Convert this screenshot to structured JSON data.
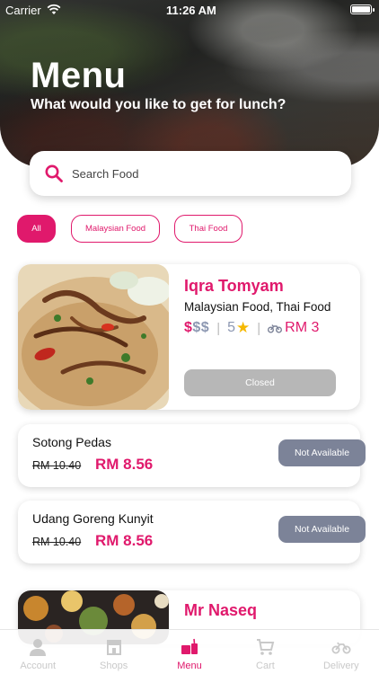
{
  "status_bar": {
    "carrier": "Carrier",
    "time": "11:26 AM"
  },
  "header": {
    "title": "Menu",
    "subtitle": "What would you like to get for lunch?"
  },
  "search": {
    "placeholder": "Search Food",
    "value": ""
  },
  "filters": [
    {
      "label": "All",
      "active": true
    },
    {
      "label": "Malaysian Food",
      "active": false
    },
    {
      "label": "Thai Food",
      "active": false
    }
  ],
  "restaurants": [
    {
      "name": "Iqra Tomyam",
      "cuisine": "Malaysian Food, Thai Food",
      "price_level_active": "$",
      "price_level_inactive": "$$",
      "rating": "5",
      "delivery_fee": "RM 3",
      "status_button": "Closed"
    },
    {
      "name": "Mr Naseq"
    }
  ],
  "menu_items": [
    {
      "name": "Sotong Pedas",
      "old_price": "RM 10.40",
      "new_price": "RM 8.56",
      "status": "Not Available"
    },
    {
      "name": "Udang Goreng Kunyit",
      "old_price": "RM 10.40",
      "new_price": "RM 8.56",
      "status": "Not Available"
    }
  ],
  "tab_bar": {
    "active": "Menu",
    "tabs": [
      {
        "label": "Account",
        "icon": "account-icon"
      },
      {
        "label": "Shops",
        "icon": "shop-icon"
      },
      {
        "label": "Menu",
        "icon": "menu-food-icon"
      },
      {
        "label": "Cart",
        "icon": "cart-icon"
      },
      {
        "label": "Delivery",
        "icon": "bike-icon"
      }
    ]
  },
  "colors": {
    "accent": "#e0196c",
    "muted": "#8d98b2",
    "closed": "#b7b7b7",
    "unavailable": "#7c8398"
  }
}
